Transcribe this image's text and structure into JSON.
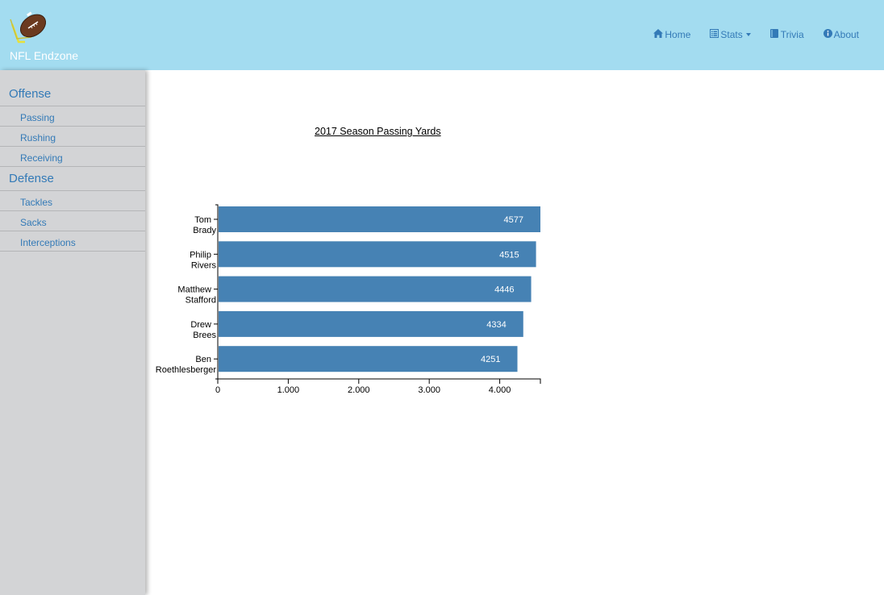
{
  "navbar": {
    "brand": "NFL Endzone",
    "items": [
      {
        "label": "Home",
        "icon": "home-icon"
      },
      {
        "label": "Stats",
        "icon": "list-icon"
      },
      {
        "label": "Trivia",
        "icon": "book-icon"
      },
      {
        "label": "About",
        "icon": "info-icon"
      }
    ]
  },
  "sidebar": {
    "offense": {
      "heading": "Offense",
      "items": [
        "Passing",
        "Rushing",
        "Receiving"
      ]
    },
    "defense": {
      "heading": "Defense",
      "items": [
        "Tackles",
        "Sacks",
        "Interceptions"
      ]
    }
  },
  "chart_data": {
    "type": "bar",
    "orientation": "horizontal",
    "title": "2017 Season Passing Yards",
    "categories": [
      [
        "Tom",
        "Brady"
      ],
      [
        "Philip",
        "Rivers"
      ],
      [
        "Matthew",
        "Stafford"
      ],
      [
        "Drew",
        "Brees"
      ],
      [
        "Ben",
        "Roethlesberger"
      ]
    ],
    "values": [
      4577,
      4515,
      4446,
      4334,
      4251
    ],
    "xlim": [
      0,
      4577
    ],
    "xticks": [
      {
        "value": 0,
        "label": "0"
      },
      {
        "value": 1000,
        "label": "1.000"
      },
      {
        "value": 2000,
        "label": "2.000"
      },
      {
        "value": 3000,
        "label": "3.000"
      },
      {
        "value": 4000,
        "label": "4.000"
      }
    ],
    "bar_color": "#4682b4",
    "xlabel": "",
    "ylabel": ""
  }
}
